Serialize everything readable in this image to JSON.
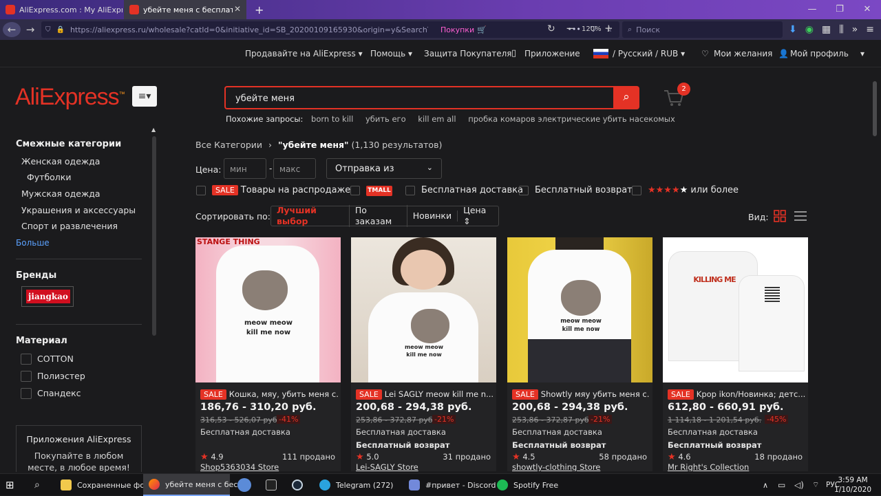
{
  "browser": {
    "tabs": [
      {
        "label": "AliExpress.com : My AliExpress",
        "active": false
      },
      {
        "label": "убейте меня с бесплатной до...",
        "active": true
      }
    ],
    "url": "https://aliexpress.ru/wholesale?catId=0&initiative_id=SB_20200109165930&origin=y&SearchText=убе",
    "shop_label": "Покупки",
    "zoom": "120%",
    "search_placeholder": "Поиск"
  },
  "topbar": {
    "sell": "Продавайте на AliExpress ▾",
    "help": "Помощь ▾",
    "protection": "Защита Покупателя",
    "app": "Приложение",
    "lang": "/ Русский /  RUB ▾",
    "wishlist": "Мои желания",
    "profile": "Мой профиль",
    "more": "▾"
  },
  "header": {
    "logo_a": "AliExpress",
    "logo_tm": "™",
    "search_value": "убейте меня",
    "related_label": "Похожие запросы:",
    "related": [
      "born to kill",
      "убить его",
      "kill em all",
      "пробка комаров электрические убить насекомых"
    ],
    "cart_count": "2"
  },
  "sidebar": {
    "related_heading": "Смежные категории",
    "categories": [
      "Женская одежда",
      "Футболки",
      "Мужская одежда",
      "Украшения и аксессуары",
      "Спорт и развлечения"
    ],
    "more": "Больше",
    "brands_heading": "Бренды",
    "brand": "jiangkao",
    "material_heading": "Материал",
    "materials": [
      "COTTON",
      "Полиэстер",
      "Спандекс"
    ],
    "app_title": "Приложения AliExpress",
    "app_text": "Покупайте в любом месте, в любое время!"
  },
  "main": {
    "crumb_all": "Все Категории",
    "crumb_query": "\"убейте меня\"",
    "crumb_count": "(1,130 результатов)",
    "price_label": "Цена:",
    "price_min": "мин",
    "price_max": "макс",
    "ship_from": "Отправка из",
    "sale_badge": "SALE",
    "filter_sale": "Товары на распродаже",
    "tmall": "TMALL",
    "filter_free": "Бесплатная доставка",
    "filter_return": "Бесплатный возврат",
    "filter_stars": "★★★★",
    "filter_star_last": "★",
    "filter_rating": "или более",
    "sort_label": "Сортировать по:",
    "sort_options": [
      "Лучший выбор",
      "По заказам",
      "Новинки",
      "Цена ⇕"
    ],
    "view_label": "Вид:"
  },
  "products": [
    {
      "title": "Кошка, мяу, убить меня с...",
      "price": "186,76 - 310,20 руб.",
      "old": "316,53 - 526,07 руб.",
      "disc": "-41%",
      "ship": "Бесплатная доставка",
      "ret": "",
      "rating": "4.9",
      "sold": "111 продано",
      "store": "Shop5363034 Store",
      "print_top": "STANGE THING",
      "print": "meow meow\nkill me now"
    },
    {
      "title": "Lei SAGLY meow kill me n...",
      "price": "200,68 - 294,38 руб.",
      "old": "253,86 - 372,87 руб.",
      "disc": "-21%",
      "ship": "Бесплатная доставка",
      "ret": "Бесплатный возврат",
      "rating": "5.0",
      "sold": "31 продано",
      "store": "Lei-SAGLY Store",
      "print_top": "",
      "print": "meow meow\nkill me now"
    },
    {
      "title": "Showtly мяу убить меня с...",
      "price": "200,68 - 294,38 руб.",
      "old": "253,86 - 372,87 руб.",
      "disc": "-21%",
      "ship": "Бесплатная доставка",
      "ret": "Бесплатный возврат",
      "rating": "4.5",
      "sold": "58 продано",
      "store": "showtly-clothing Store",
      "print_top": "",
      "print": "meow meow\nkill me now"
    },
    {
      "title": "Kpop ikon/Новинка; детс...",
      "price": "612,80 - 660,91 руб.",
      "old": "1 114,18 - 1 201,54 руб.",
      "disc": "-45%",
      "ship": "Бесплатная доставка",
      "ret": "Бесплатный возврат",
      "rating": "4.6",
      "sold": "18 продано",
      "store": "Mr Right's Collection",
      "print_top": "",
      "print": "KILLING ME"
    }
  ],
  "taskbar": {
    "items": [
      "Сохраненные фот...",
      "убейте меня с бес...",
      "Telegram (272)",
      "#привет - Discord",
      "Spotify Free"
    ],
    "lang": "РУС",
    "time": "3:59 AM",
    "date": "1/10/2020"
  },
  "colors": {
    "accent": "#e43225",
    "orange": "#f7941d",
    "link": "#5ba2ff"
  }
}
